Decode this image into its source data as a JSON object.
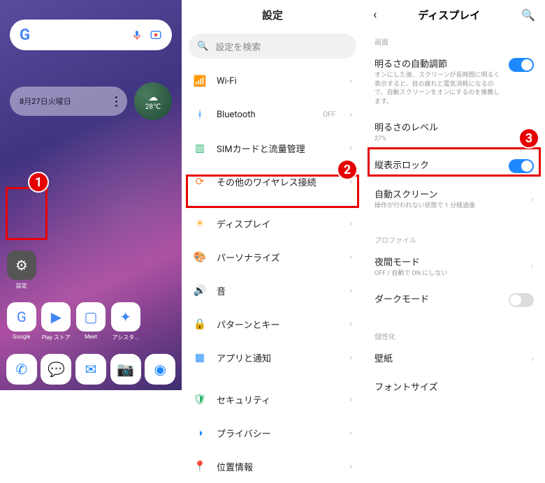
{
  "markers": {
    "one": "1",
    "two": "2",
    "three": "3"
  },
  "home": {
    "date": "8月27日火曜日",
    "temp": "28℃",
    "apps": [
      {
        "label": "設定",
        "bg": "#555",
        "fg": "#fff",
        "glyph": "⚙"
      },
      {
        "label": "",
        "bg": "transparent",
        "glyph": ""
      },
      {
        "label": "",
        "bg": "transparent",
        "glyph": ""
      },
      {
        "label": "",
        "bg": "transparent",
        "glyph": ""
      },
      {
        "label": "",
        "bg": "transparent",
        "glyph": ""
      },
      {
        "label": "Google",
        "bg": "#fff",
        "glyph": "G"
      },
      {
        "label": "Play ストア",
        "bg": "#fff",
        "glyph": "▶"
      },
      {
        "label": "Meet",
        "bg": "#fff",
        "glyph": "▢"
      },
      {
        "label": "アシスタ...",
        "bg": "#fff",
        "glyph": "✦"
      },
      {
        "label": "",
        "bg": "transparent",
        "glyph": ""
      }
    ],
    "dock": [
      {
        "bg": "#fff",
        "fg": "#1e88ff",
        "glyph": "✆"
      },
      {
        "bg": "#fff",
        "fg": "#1e88ff",
        "glyph": "💬"
      },
      {
        "bg": "#fff",
        "fg": "#1e88ff",
        "glyph": "✉"
      },
      {
        "bg": "#fff",
        "fg": "#e63946",
        "glyph": "📷"
      },
      {
        "bg": "#fff",
        "fg": "#1e88ff",
        "glyph": "◉"
      }
    ]
  },
  "settings": {
    "title": "設定",
    "search_ph": "設定を検索",
    "items": [
      {
        "icon": "📶",
        "cls": "c-wifi",
        "label": "Wi-Fi",
        "tag": ""
      },
      {
        "icon": "ᚼ",
        "cls": "c-bt",
        "label": "Bluetooth",
        "tag": "OFF"
      },
      {
        "icon": "▥",
        "cls": "c-sim",
        "label": "SIMカードと流量管理",
        "tag": ""
      },
      {
        "icon": "⟳",
        "cls": "c-wire",
        "label": "その他のワイヤレス接続",
        "tag": ""
      }
    ],
    "items2": [
      {
        "icon": "☀",
        "cls": "c-disp",
        "label": "ディスプレイ",
        "tag": ""
      },
      {
        "icon": "🎨",
        "cls": "c-pers",
        "label": "パーソナライズ",
        "tag": ""
      },
      {
        "icon": "🔊",
        "cls": "c-snd",
        "label": "音",
        "tag": ""
      },
      {
        "icon": "🔒",
        "cls": "c-pat",
        "label": "パターンとキー",
        "tag": ""
      },
      {
        "icon": "▦",
        "cls": "c-app",
        "label": "アプリと通知",
        "tag": ""
      }
    ],
    "items3": [
      {
        "icon": "🛡",
        "cls": "c-sec",
        "label": "セキュリティ",
        "tag": ""
      },
      {
        "icon": "◑",
        "cls": "c-priv",
        "label": "プライバシー",
        "tag": ""
      },
      {
        "icon": "📍",
        "cls": "c-loc",
        "label": "位置情報",
        "tag": ""
      }
    ]
  },
  "display": {
    "title": "ディスプレイ",
    "sec_screen": "画面",
    "auto_bright_title": "明るさの自動調節",
    "auto_bright_sub": "オンにした後、スクリーンが長時間に明るく表示すると、目の疲れと電気消耗になるので、自動スクリーンをオンにするのを推薦します。",
    "bright_level_title": "明るさのレベル",
    "bright_level_sub": "27%",
    "portrait_lock": "縦表示ロック",
    "auto_screen_title": "自動スクリーン",
    "auto_screen_sub": "操作が行われない状態で 1 分経過後",
    "sec_profile": "プロファイル",
    "night_title": "夜間モード",
    "night_sub": "OFF / 自動で ON にしない",
    "dark_title": "ダークモード",
    "sec_personal": "個性化",
    "wallpaper": "壁紙",
    "font": "フォントサイズ"
  }
}
